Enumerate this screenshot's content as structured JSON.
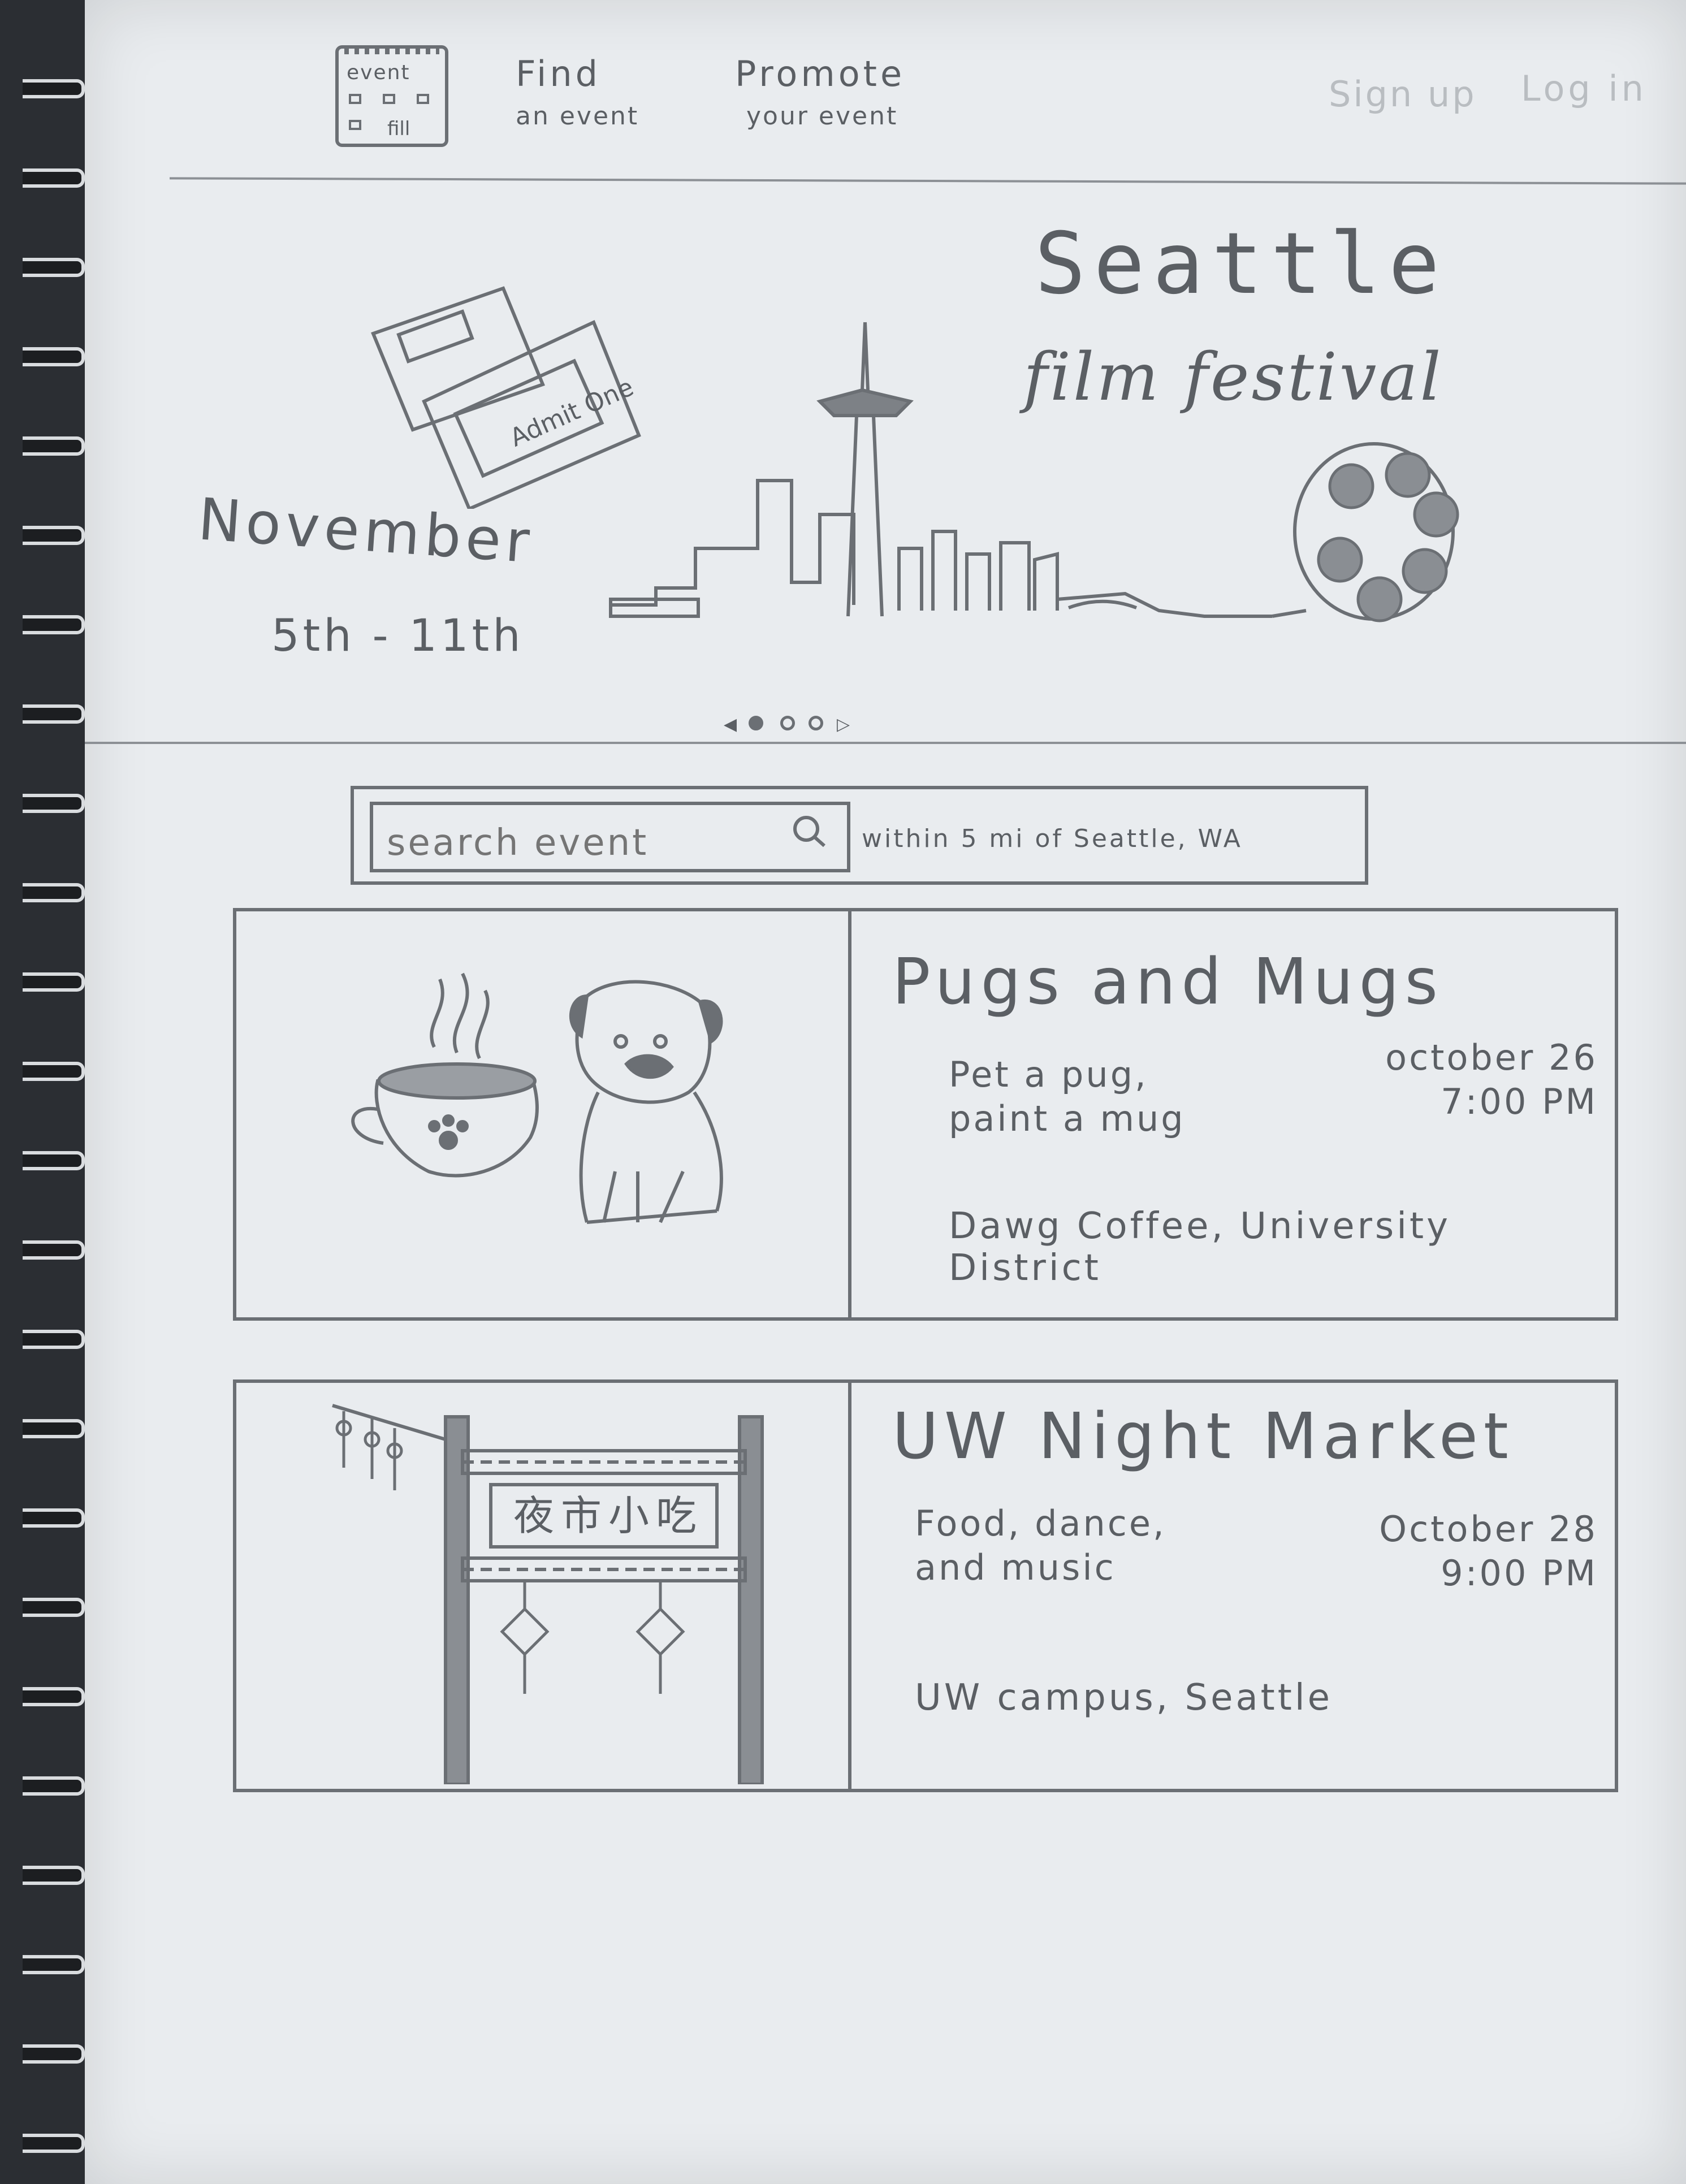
{
  "header": {
    "logo_text": "event",
    "logo_sub": "fill",
    "find_label": "Find",
    "find_sub": "an event",
    "promote_label": "Promote",
    "promote_sub": "your event",
    "signup_label": "Sign up",
    "login_label": "Log in"
  },
  "hero": {
    "title": "Seattle",
    "subtitle": "film festival",
    "date_month": "November",
    "date_range": "5th - 11th",
    "ticket_text": "Admit One",
    "carousel_dots": 4,
    "carousel_active": 0
  },
  "search": {
    "placeholder": "search event",
    "location": "within 5 mi of Seattle, WA"
  },
  "events": [
    {
      "title": "Pugs and Mugs",
      "description": "Pet a pug,\npaint a mug",
      "date": "october 26",
      "time": "7:00 PM",
      "location": "Dawg Coffee, University District",
      "icons": [
        "coffee-cup-icon",
        "pug-icon"
      ]
    },
    {
      "title": "UW Night Market",
      "description": "Food, dance,\nand music",
      "date": "October 28",
      "time": "9:00 PM",
      "location": "UW campus, Seattle",
      "gate_sign": "夜市小吃",
      "icons": [
        "market-gate-icon",
        "lantern-icon"
      ]
    }
  ],
  "colors": {
    "paper": "#e9ecef",
    "pencil": "#5b5f64",
    "faint_pencil": "#b9bdc1",
    "binding": "#2b2e33"
  }
}
